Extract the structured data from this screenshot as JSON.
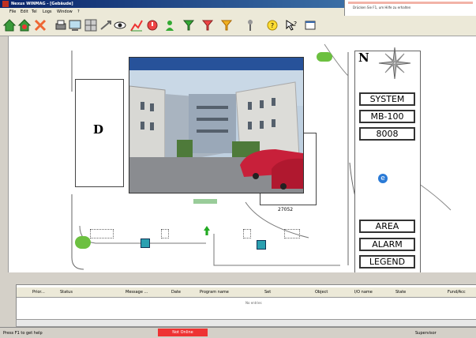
{
  "window": {
    "title": "Nexus WINMAG - [Gebäude]"
  },
  "menu": [
    "File",
    "Edit",
    "Tel",
    "Logs",
    "Window",
    "?"
  ],
  "hint": {
    "text": "Drücken Sie F1, um Hilfe zu erhalten"
  },
  "map": {
    "building_label": "D",
    "compass_label": "N",
    "room_number": "27052",
    "side_buttons": [
      "SYSTEM",
      "MB-100",
      "8008",
      "AREA",
      "ALARM",
      "LEGEND"
    ]
  },
  "event_table": {
    "columns": [
      "Prior...",
      "Status",
      "Message ...",
      "Date",
      "Program name",
      "Set",
      "Object",
      "I/O name",
      "State",
      "Fund/Acc"
    ],
    "empty_text": "No entries"
  },
  "statusbar": {
    "help": "Press F1 to get help",
    "alarm": "Not Online",
    "user": "Supervisor"
  },
  "colors": {
    "title": "#0a246a",
    "video_header": "#27529a",
    "alarm": "#ee3333",
    "marker_teal": "#2aa0b0",
    "marker_green": "#6cc040"
  }
}
